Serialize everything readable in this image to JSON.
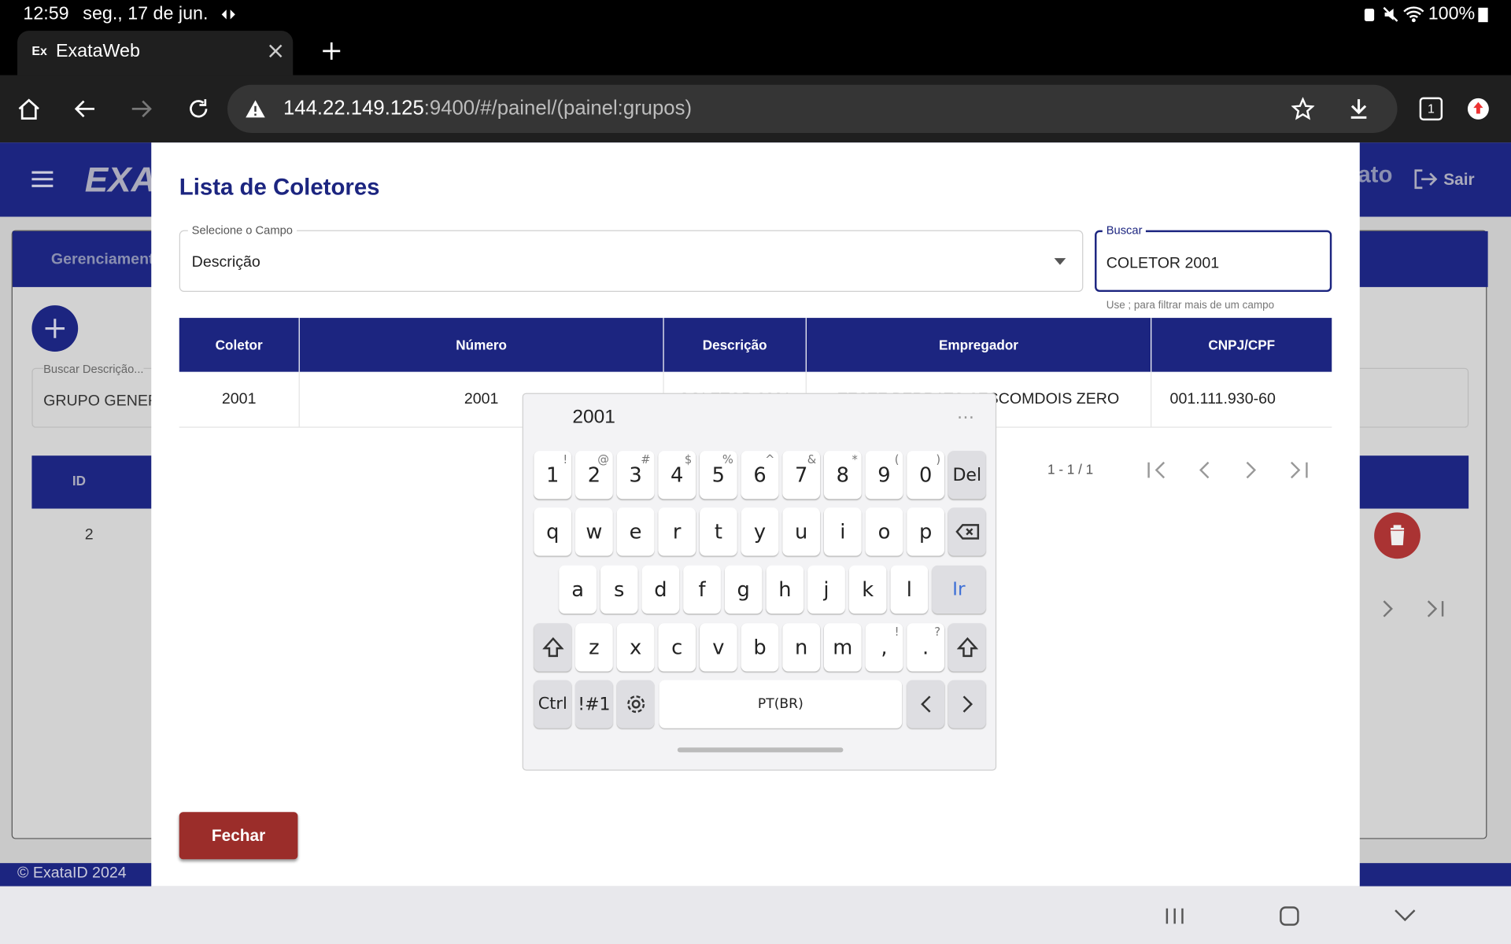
{
  "status": {
    "time": "12:59",
    "date": "seg., 17 de jun.",
    "battery": "100%"
  },
  "browser": {
    "tab_favicon": "Ex",
    "tab_title": "ExataWeb",
    "url_host": "144.22.149.125",
    "url_rest": ":9400/#/painel/(painel:grupos)",
    "tab_count": "1"
  },
  "app": {
    "logo": "EXA",
    "user_suffix": "ato",
    "logout": "Sair",
    "tab_label": "Gerenciament",
    "search_label": "Buscar Descrição...",
    "search_value": "GRUPO GENER",
    "table_id_header": "ID",
    "row_id": "2",
    "footer": "© ExataID 2024"
  },
  "dialog": {
    "title": "Lista de Coletores",
    "select_label": "Selecione o Campo",
    "select_value": "Descrição",
    "search_label": "Buscar",
    "search_value": "COLETOR 2001",
    "hint": "Use ; para filtrar mais de um campo",
    "columns": [
      "Coletor",
      "Número",
      "Descrição",
      "Empregador",
      "CNPJ/CPF"
    ],
    "row": {
      "coletor": "2001",
      "numero": "2001",
      "descricao": "COLETOR 2001",
      "empregador": "TESTE BERRATO 0ESCOMDOIS ZERO",
      "cnpj": "001.111.930-60"
    },
    "paginator": "1 - 1 / 1",
    "close": "Fechar"
  },
  "keyboard": {
    "suggestion": "2001",
    "row1": [
      [
        "1",
        "!"
      ],
      [
        "2",
        "@"
      ],
      [
        "3",
        "#"
      ],
      [
        "4",
        "$"
      ],
      [
        "5",
        "%"
      ],
      [
        "6",
        "^"
      ],
      [
        "7",
        "&"
      ],
      [
        "8",
        "*"
      ],
      [
        "9",
        "("
      ],
      [
        "0",
        ")"
      ]
    ],
    "del": "Del",
    "row2": [
      "q",
      "w",
      "e",
      "r",
      "t",
      "y",
      "u",
      "i",
      "o",
      "p"
    ],
    "row3": [
      "a",
      "s",
      "d",
      "f",
      "g",
      "h",
      "j",
      "k",
      "l"
    ],
    "go": "Ir",
    "row4": [
      "z",
      "x",
      "c",
      "v",
      "b",
      "n",
      "m"
    ],
    "comma": [
      ",",
      "!"
    ],
    "period": [
      ".",
      "?"
    ],
    "ctrl": "Ctrl",
    "sym": "!#1",
    "space": "PT(BR)"
  },
  "colors": {
    "brand": "#1c2580",
    "close_button": "#9b2d2a",
    "go_key": "#3d6fd6"
  }
}
